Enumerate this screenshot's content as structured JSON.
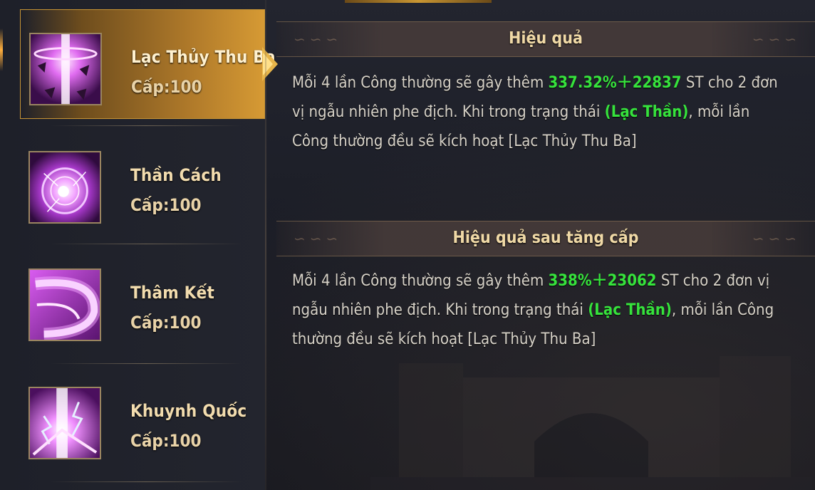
{
  "skills": [
    {
      "name": "Lạc Thủy Thu Ba",
      "level": "Cấp:100",
      "selected": true,
      "icon": "water-wave-skill-icon"
    },
    {
      "name": "Thần Cách",
      "level": "Cấp:100",
      "selected": false,
      "icon": "orb-sphere-skill-icon"
    },
    {
      "name": "Thâm Kết",
      "level": "Cấp:100",
      "selected": false,
      "icon": "crescent-slash-skill-icon"
    },
    {
      "name": "Khuynh Quốc",
      "level": "Cấp:100",
      "selected": false,
      "icon": "lightning-burst-skill-icon"
    }
  ],
  "effect": {
    "title": "Hiệu quả",
    "text1": "Mỗi 4 lần Công thường sẽ gây thêm ",
    "value": "337.32%＋22837",
    "text2": " ST cho 2 đơn vị ngẫu nhiên phe địch. Khi trong trạng thái ",
    "state": "(Lạc Thần)",
    "text3": ", mỗi lần Công thường đều sẽ kích hoạt [Lạc Thủy Thu Ba]"
  },
  "upgrade_effect": {
    "title": "Hiệu quả sau tăng cấp",
    "text1": "Mỗi 4 lần Công thường sẽ gây thêm ",
    "value": "338%＋23062",
    "text2": " ST cho 2 đơn vị ngẫu nhiên phe địch. Khi trong trạng thái ",
    "state": "(Lạc Thần)",
    "text3": ", mỗi lần Công thường đều sẽ kích hoạt [Lạc Thủy Thu Ba]"
  },
  "colors": {
    "highlight_green": "#36e23c",
    "gold_text": "#f0d9a6",
    "selected_bg": "#b07a2a"
  }
}
